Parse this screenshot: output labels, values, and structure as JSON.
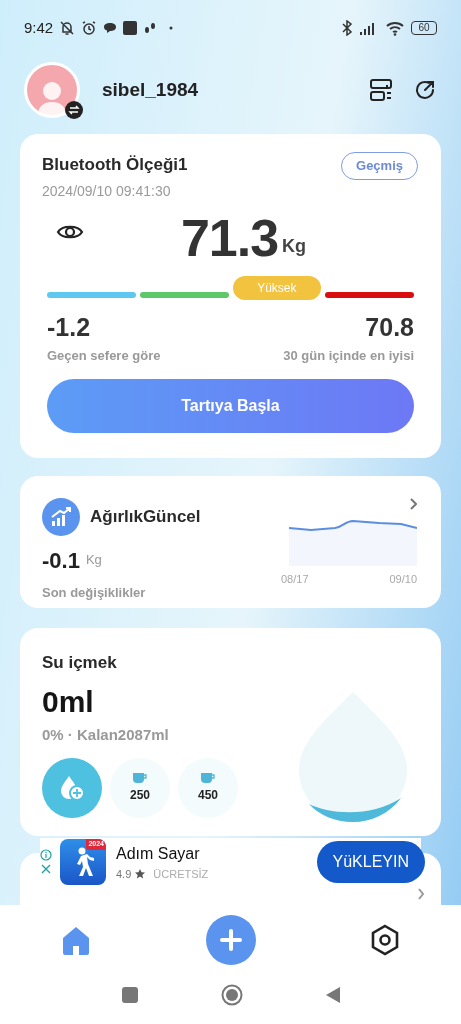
{
  "status_bar": {
    "time": "9:42",
    "battery": "60"
  },
  "header": {
    "username": "sibel_1984"
  },
  "scale_card": {
    "device": "Bluetooth Ölçeği1",
    "history_button": "Geçmiş",
    "timestamp": "2024/09/10 09:41:30",
    "weight": "71.3",
    "unit": "Kg",
    "segments": [
      {
        "color": "#5ec8f0",
        "selected": false
      },
      {
        "color": "#5cc86a",
        "selected": false
      },
      {
        "color": "#f2c33e",
        "selected": true,
        "label": "Yüksek"
      },
      {
        "color": "#d90f0f",
        "selected": false
      }
    ],
    "stats": [
      {
        "value": "-1.2",
        "label": "Geçen sefere göre"
      },
      {
        "value": "70.8",
        "label": "30 gün içinde en iyisi"
      }
    ],
    "start_button": "Tartıya Başla"
  },
  "trend_card": {
    "title": "AğırlıkGüncel",
    "value": "-0.1",
    "unit": "Kg",
    "caption": "Son değişiklikler",
    "x_labels": [
      "08/17",
      "09/10"
    ]
  },
  "water_card": {
    "title": "Su içmek",
    "amount": "0ml",
    "summary": "0% · Kalan2087ml",
    "cups": [
      "250",
      "450"
    ]
  },
  "ad": {
    "app_name": "Adım Sayar",
    "rating": "4.9",
    "price": "ÜCRETSİZ",
    "badge": "2024",
    "install_button": "YüKLEYIN"
  },
  "bottom_nav": [
    {
      "kind": "home",
      "selected": true
    },
    {
      "kind": "add",
      "selected": false
    },
    {
      "kind": "settings",
      "selected": false
    }
  ]
}
